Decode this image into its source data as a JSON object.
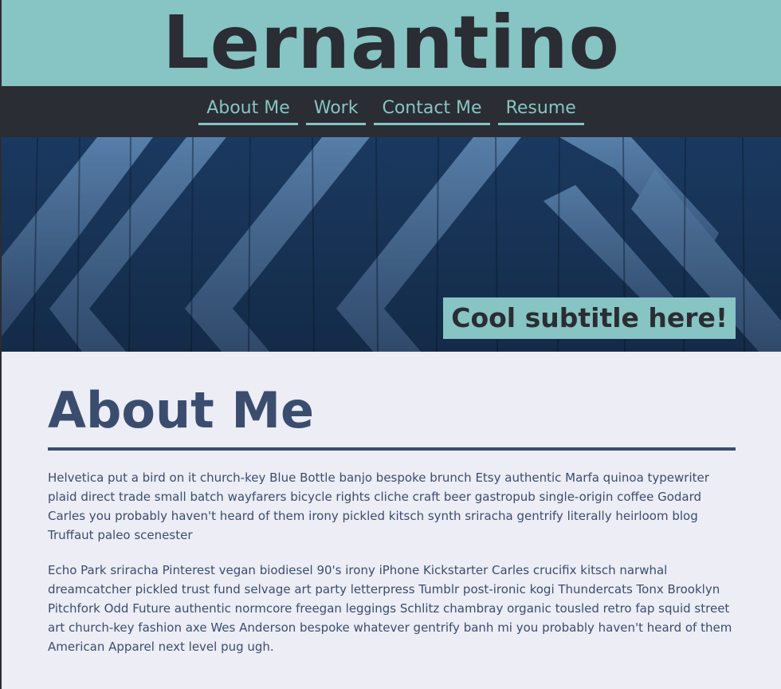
{
  "header": {
    "site_title": "Lernantino"
  },
  "nav": {
    "items": [
      {
        "label": "About Me"
      },
      {
        "label": "Work"
      },
      {
        "label": "Contact Me"
      },
      {
        "label": "Resume"
      }
    ]
  },
  "hero": {
    "subtitle": "Cool subtitle here!"
  },
  "about": {
    "heading": "About Me",
    "paragraphs": [
      "Helvetica put a bird on it church-key Blue Bottle banjo bespoke brunch Etsy authentic Marfa quinoa typewriter plaid direct trade small batch wayfarers bicycle rights cliche craft beer gastropub single-origin coffee Godard Carles you probably haven't heard of them irony pickled kitsch synth sriracha gentrify literally heirloom blog Truffaut paleo scenester",
      "Echo Park sriracha Pinterest vegan biodiesel 90's irony iPhone Kickstarter Carles crucifix kitsch narwhal dreamcatcher pickled trust fund selvage art party letterpress Tumblr post-ironic kogi Thundercats Tonx Brooklyn Pitchfork Odd Future authentic normcore freegan leggings Schlitz chambray organic tousled retro fap squid street art church-key fashion axe Wes Anderson bespoke whatever gentrify banh mi you probably haven't heard of them American Apparel next level pug ugh."
    ]
  },
  "colors": {
    "accent": "#87c4c4",
    "dark": "#2a2d33",
    "heading": "#3b4d6e",
    "background": "#ecedf5"
  }
}
